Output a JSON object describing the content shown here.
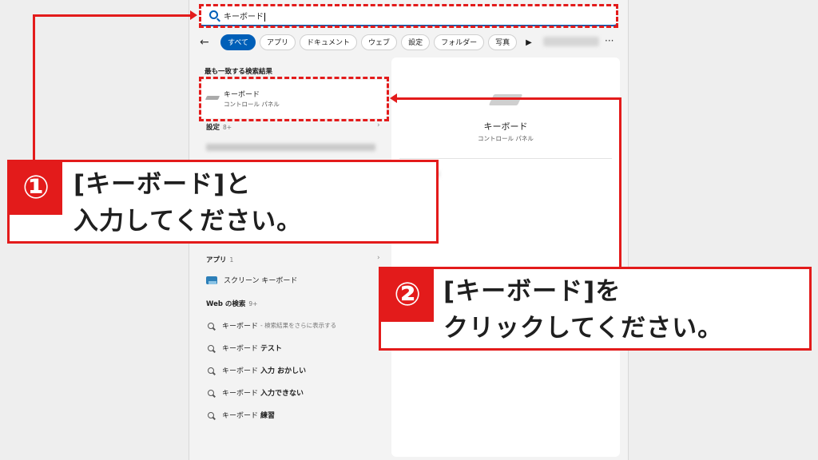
{
  "search": {
    "query": "キーボード"
  },
  "filters": [
    "すべて",
    "アプリ",
    "ドキュメント",
    "ウェブ",
    "設定",
    "フォルダー",
    "写真"
  ],
  "best_match": {
    "heading": "最も一致する検索結果",
    "title": "キーボード",
    "subtitle": "コントロール パネル"
  },
  "settings_section": {
    "label": "設定",
    "count": "8+"
  },
  "apps_section": {
    "label": "アプリ",
    "count": "1",
    "item": "スクリーン キーボード"
  },
  "web_section": {
    "label": "Web の検索",
    "count": "9+",
    "items": [
      {
        "prefix": "キーボード",
        "suffix": "",
        "hint": "- 検索結果をさらに表示する"
      },
      {
        "prefix": "キーボード",
        "suffix": "テスト",
        "hint": ""
      },
      {
        "prefix": "キーボード",
        "suffix": "入力 おかしい",
        "hint": ""
      },
      {
        "prefix": "キーボード",
        "suffix": "入力できない",
        "hint": ""
      },
      {
        "prefix": "キーボード",
        "suffix": "練習",
        "hint": ""
      }
    ]
  },
  "preview": {
    "title": "キーボード",
    "subtitle": "コントロール パネル"
  },
  "callout1": {
    "number": "①",
    "line1": "[キーボード]と",
    "line2": "入力してください。"
  },
  "callout2": {
    "number": "②",
    "line1": "[キーボード]を",
    "line2": "クリックしてください。"
  },
  "colors": {
    "accent": "#005fb8",
    "annotation": "#e31b1b"
  }
}
